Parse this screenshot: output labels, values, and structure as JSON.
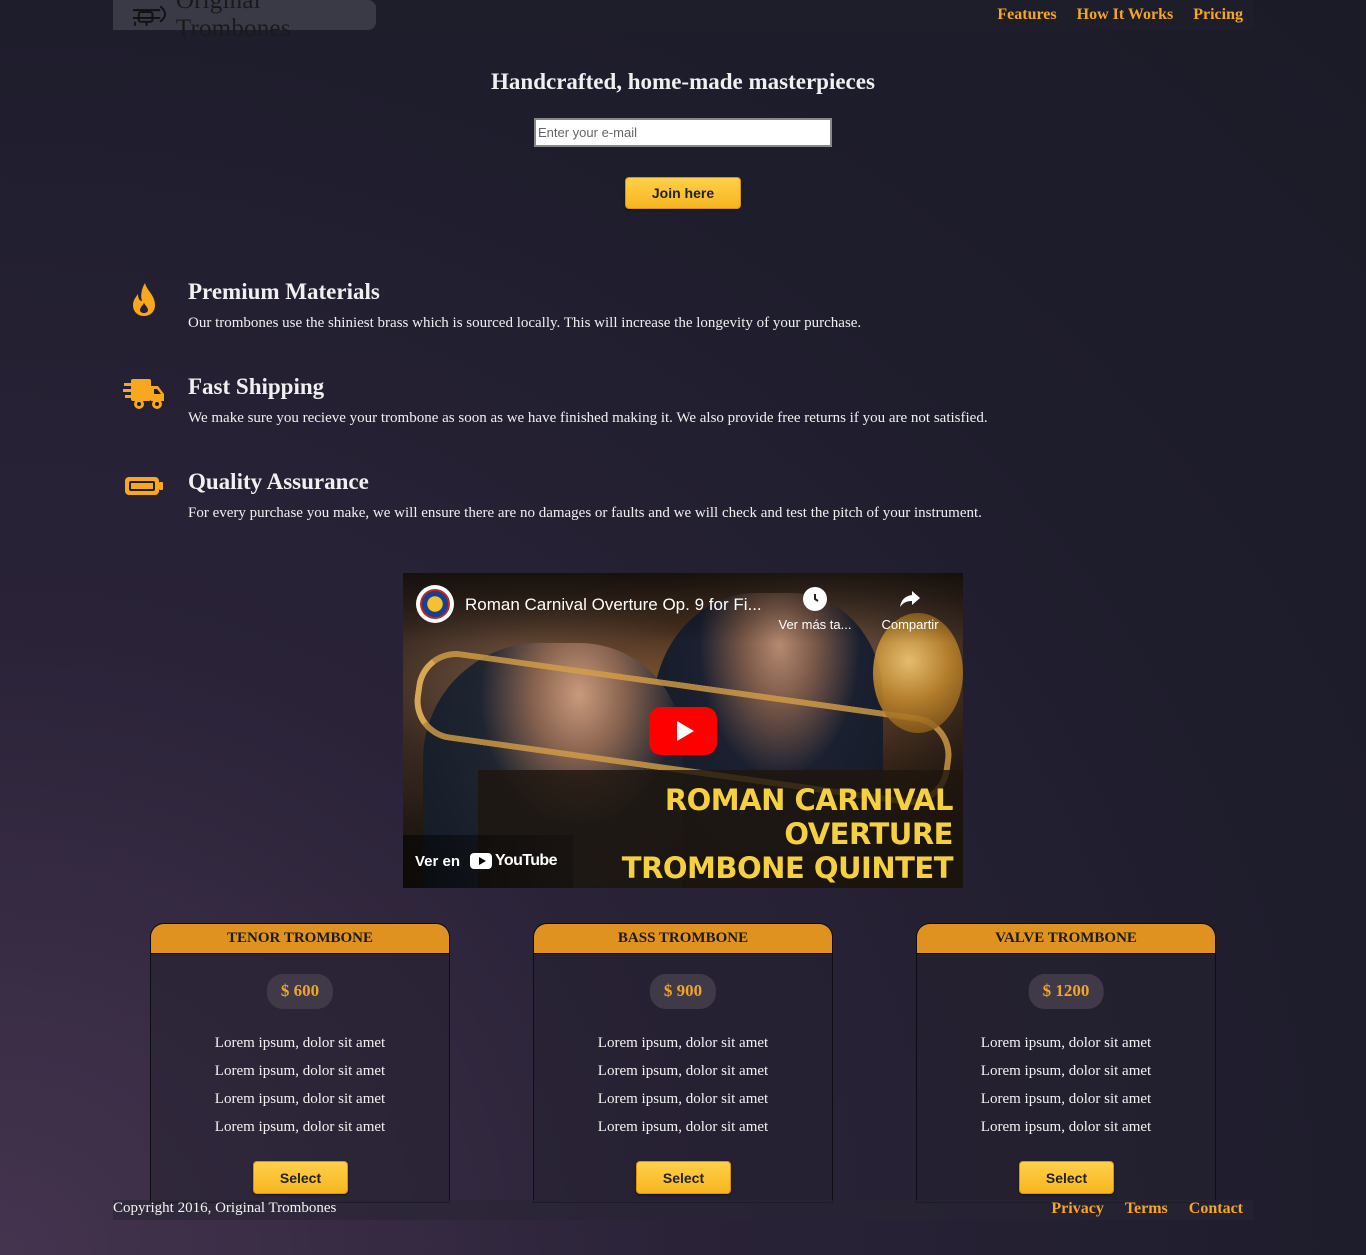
{
  "header": {
    "logo_text": "Original Trombones",
    "nav": [
      "Features",
      "How It Works",
      "Pricing"
    ]
  },
  "hero": {
    "title": "Handcrafted, home-made masterpieces",
    "email_placeholder": "Enter your e-mail",
    "join_label": "Join here"
  },
  "features": [
    {
      "icon": "fire-icon",
      "title": "Premium Materials",
      "text": "Our trombones use the shiniest brass which is sourced locally. This will increase the longevity of your purchase."
    },
    {
      "icon": "truck-icon",
      "title": "Fast Shipping",
      "text": "We make sure you recieve your trombone as soon as we have finished making it. We also provide free returns if you are not satisfied."
    },
    {
      "icon": "battery-icon",
      "title": "Quality Assurance",
      "text": "For every purchase you make, we will ensure there are no damages or faults and we will check and test the pitch of your instrument."
    }
  ],
  "video": {
    "title": "Roman Carnival Overture Op. 9 for Fi...",
    "watch_later": "Ver más ta...",
    "share": "Compartir",
    "banner_line1": "ROMAN CARNIVAL OVERTURE",
    "banner_line2": "TROMBONE QUINTET",
    "watch_on": "Ver en",
    "youtube": "YouTube"
  },
  "pricing": [
    {
      "name": "TENOR TROMBONE",
      "price": "$ 600",
      "features": [
        "Lorem ipsum, dolor sit amet",
        "Lorem ipsum, dolor sit amet",
        "Lorem ipsum, dolor sit amet",
        "Lorem ipsum, dolor sit amet"
      ],
      "button": "Select"
    },
    {
      "name": "BASS TROMBONE",
      "price": "$ 900",
      "features": [
        "Lorem ipsum, dolor sit amet",
        "Lorem ipsum, dolor sit amet",
        "Lorem ipsum, dolor sit amet",
        "Lorem ipsum, dolor sit amet"
      ],
      "button": "Select"
    },
    {
      "name": "VALVE TROMBONE",
      "price": "$ 1200",
      "features": [
        "Lorem ipsum, dolor sit amet",
        "Lorem ipsum, dolor sit amet",
        "Lorem ipsum, dolor sit amet",
        "Lorem ipsum, dolor sit amet"
      ],
      "button": "Select"
    }
  ],
  "footer": {
    "copyright": "Copyright 2016, Original Trombones",
    "links": [
      "Privacy",
      "Terms",
      "Contact"
    ]
  },
  "colors": {
    "accent": "#f5a623",
    "card_header": "#e09220",
    "youtube_red": "#ff0000"
  }
}
